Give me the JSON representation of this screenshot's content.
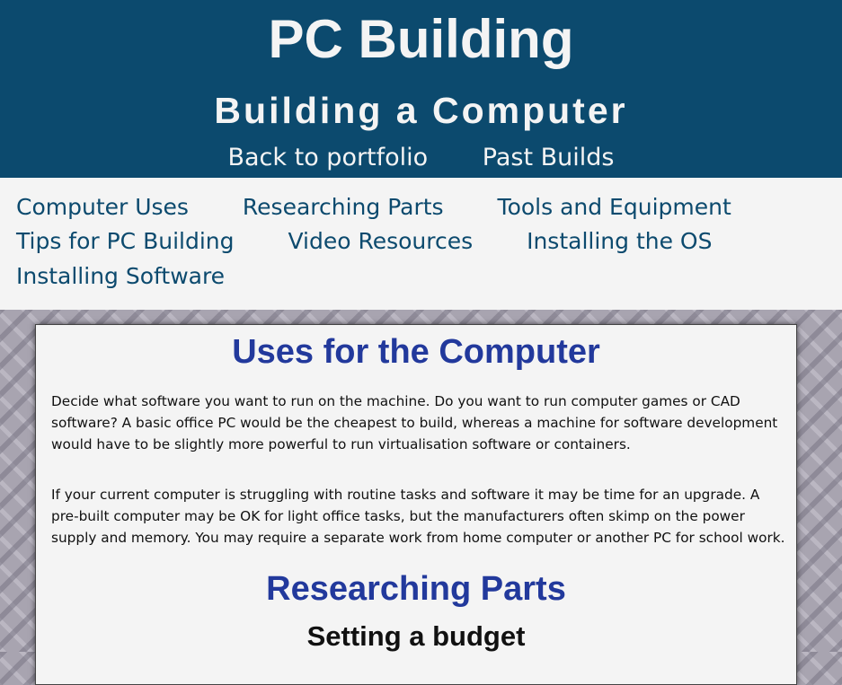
{
  "header": {
    "title": "PC Building",
    "subtitle": "Building a Computer",
    "links": [
      "Back to portfolio",
      "Past Builds"
    ]
  },
  "nav": {
    "rows": [
      [
        "Computer Uses",
        "Researching Parts",
        "Tools and Equipment"
      ],
      [
        "Tips for PC Building",
        "Video Resources",
        "Installing the OS"
      ],
      [
        "Installing Software"
      ]
    ]
  },
  "content": {
    "uses_heading": "Uses for the Computer",
    "uses_paragraphs": [
      "Decide what software you want to run on the machine. Do you want to run computer games or CAD software? A basic office PC would be the cheapest to build, whereas a machine for software development would have to be slightly more powerful to run virtualisation software or containers.",
      "If your current computer is struggling with routine tasks and software it may be time for an upgrade. A pre-built computer may be OK for light office tasks, but the manufacturers often skimp on the power supply and memory. You may require a separate work from home computer or another PC for school work."
    ],
    "research_heading": "Researching Parts",
    "budget_heading": "Setting a budget"
  },
  "colors": {
    "header_bg": "#0c4a6e",
    "nav_link": "#0c4a6e",
    "heading_blue": "#22399c",
    "panel_bg": "#f4f4f4"
  }
}
